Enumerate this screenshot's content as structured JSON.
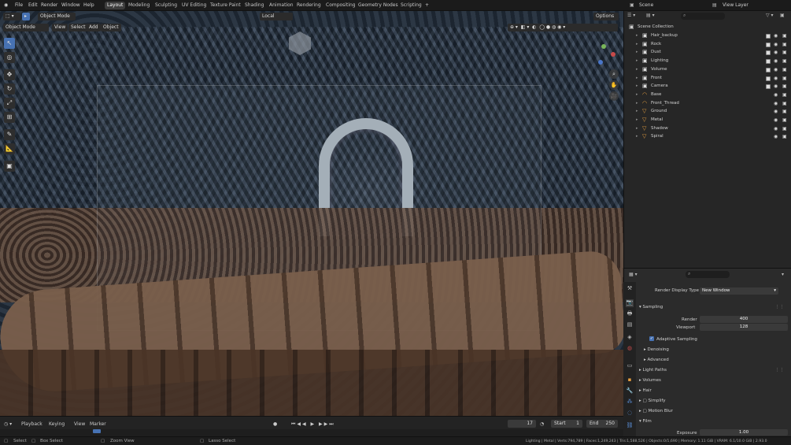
{
  "topbar": {
    "menus": [
      "File",
      "Edit",
      "Render",
      "Window",
      "Help"
    ],
    "workspaces": [
      "Layout",
      "Modeling",
      "Sculpting",
      "UV Editing",
      "Texture Paint",
      "Shading",
      "Animation",
      "Rendering",
      "Compositing",
      "Geometry Nodes",
      "Scripting"
    ],
    "active_workspace": "Layout",
    "add_tab": "+",
    "scene": "Scene",
    "view_layer": "View Layer"
  },
  "viewport": {
    "mode": "Object Mode",
    "menus": [
      "View",
      "Select",
      "Add",
      "Object"
    ],
    "orientation": "Local",
    "options": "Options"
  },
  "timeline": {
    "menus": [
      "Playback",
      "Keying",
      "View",
      "Marker"
    ],
    "current_frame": "17",
    "start_label": "Start",
    "start": "1",
    "end_label": "End",
    "end": "250"
  },
  "statusbar": {
    "select": "Select",
    "box_select": "Box Select",
    "zoom_view": "Zoom View",
    "lasso_select": "Lasso Select",
    "stats": "Lighting | Metal | Verts:794,789 | Faces:1,249,243 | Tris:1,588,526 | Objects:0/1,690 | Memory: 1.11 GiB | VRAM: 6.1/10.0 GiB | 2.93.0"
  },
  "outliner": {
    "root": "Scene Collection",
    "items": [
      {
        "name": "Hair_backup",
        "icon": "collection-icon"
      },
      {
        "name": "Rock",
        "icon": "collection-icon"
      },
      {
        "name": "Dust",
        "icon": "collection-icon"
      },
      {
        "name": "Lighting",
        "icon": "collection-icon"
      },
      {
        "name": "Volume",
        "icon": "collection-icon"
      },
      {
        "name": "Front",
        "icon": "collection-icon"
      },
      {
        "name": "Camera",
        "icon": "collection-icon"
      },
      {
        "name": "Base",
        "icon": "curve-icon"
      },
      {
        "name": "Front_Thread",
        "icon": "curve-icon"
      },
      {
        "name": "Ground",
        "icon": "mesh-icon"
      },
      {
        "name": "Metal",
        "icon": "mesh-icon"
      },
      {
        "name": "Shadow",
        "icon": "mesh-icon"
      },
      {
        "name": "Spiral",
        "icon": "mesh-icon"
      }
    ]
  },
  "properties": {
    "render_display_label": "Render Display Type",
    "render_display_value": "New Window",
    "sampling": "Sampling",
    "render_label": "Render",
    "render_value": "400",
    "viewport_label": "Viewport",
    "viewport_value": "128",
    "adaptive_sampling": "Adaptive Sampling",
    "denoising": "Denoising",
    "advanced": "Advanced",
    "light_paths": "Light Paths",
    "volumes": "Volumes",
    "hair": "Hair",
    "simplify": "Simplify",
    "motion_blur": "Motion Blur",
    "film": "Film",
    "exposure_label": "Exposure",
    "exposure_value": "1.00"
  },
  "colors": {
    "accent": "#4772b3",
    "orange": "#e8a040",
    "bg": "#1d1d1d"
  }
}
